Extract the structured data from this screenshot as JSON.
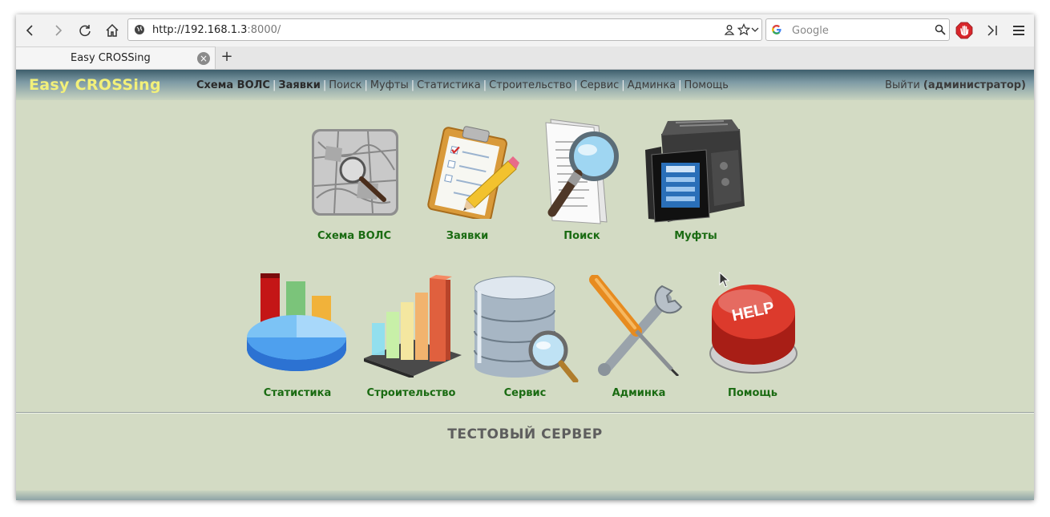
{
  "browser": {
    "url_host": "http://192.168.1.3",
    "url_port": ":8000/",
    "search_placeholder": "Google",
    "tab_title": "Easy CROSSing",
    "new_tab_label": "+"
  },
  "site": {
    "logo": "Easy CROSSing",
    "nav": [
      {
        "label": "Схема ВОЛС",
        "bold": true
      },
      {
        "label": "Заявки",
        "bold": true
      },
      {
        "label": "Поиск",
        "bold": false
      },
      {
        "label": "Муфты",
        "bold": false
      },
      {
        "label": "Статистика",
        "bold": false
      },
      {
        "label": "Строительство",
        "bold": false
      },
      {
        "label": "Сервис",
        "bold": false
      },
      {
        "label": "Админка",
        "bold": false
      },
      {
        "label": "Помощь",
        "bold": false
      }
    ],
    "nav_separator": "|",
    "logout": "Выйти",
    "user": "(администратор)",
    "tiles_row1": [
      {
        "label": "Схема ВОЛС",
        "icon": "map-magnifier-icon"
      },
      {
        "label": "Заявки",
        "icon": "clipboard-pencil-icon"
      },
      {
        "label": "Поиск",
        "icon": "document-magnifier-icon"
      },
      {
        "label": "Муфты",
        "icon": "fusion-splicer-icon"
      }
    ],
    "tiles_row2": [
      {
        "label": "Статистика",
        "icon": "pie-bar-chart-icon"
      },
      {
        "label": "Строительство",
        "icon": "bar-chart-icon"
      },
      {
        "label": "Сервис",
        "icon": "database-search-icon"
      },
      {
        "label": "Админка",
        "icon": "tools-icon"
      },
      {
        "label": "Помощь",
        "icon": "help-button-icon",
        "badge": "HELP"
      }
    ],
    "server_note": "ТЕСТОВЫЙ СЕРВЕР"
  }
}
